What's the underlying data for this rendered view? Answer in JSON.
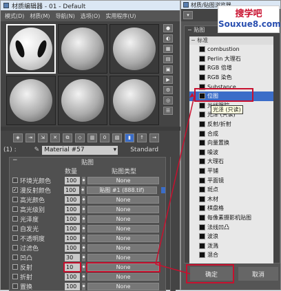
{
  "editor": {
    "title": "材质编辑器 - 01 - Default",
    "menu": [
      "模式(D)",
      "材质(M)",
      "导航(N)",
      "选项(O)",
      "实用程序(U)"
    ],
    "material_index": "(1) :",
    "material_name": "Material #57",
    "material_type": "Standard",
    "rollout_title": "贴图",
    "col_amount": "数量",
    "col_maptype": "贴图类型",
    "rows": [
      {
        "check": "",
        "label": "环境光颜色",
        "amount": "100",
        "map": "None"
      },
      {
        "check": "✓",
        "label": "漫反射颜色",
        "amount": "100",
        "map": "贴图 #1 (888.tif)"
      },
      {
        "check": "",
        "label": "高光颜色",
        "amount": "100",
        "map": "None"
      },
      {
        "check": "",
        "label": "高光级别",
        "amount": "100",
        "map": "None"
      },
      {
        "check": "",
        "label": "光泽度",
        "amount": "100",
        "map": "None"
      },
      {
        "check": "",
        "label": "自发光",
        "amount": "100",
        "map": "None"
      },
      {
        "check": "",
        "label": "不透明度",
        "amount": "100",
        "map": "None"
      },
      {
        "check": "",
        "label": "过滤色",
        "amount": "100",
        "map": "None"
      },
      {
        "check": "",
        "label": "凹凸",
        "amount": "30",
        "map": "None"
      },
      {
        "check": "",
        "label": "反射",
        "amount": "10",
        "map": "None"
      },
      {
        "check": "",
        "label": "折射",
        "amount": "100",
        "map": "None"
      },
      {
        "check": "",
        "label": "置换",
        "amount": "100",
        "map": "None"
      }
    ]
  },
  "browser": {
    "title": "材质/贴图浏览器",
    "section": "贴图",
    "subsection": "标准",
    "items": [
      "combustion",
      "Perlin 大理石",
      "RGB 倍增",
      "RGB 染色",
      "Substance",
      "位图",
      "光线跟踪",
      "光泽 (只读)",
      "反射/折射",
      "合成",
      "向量置换",
      "噪波",
      "大理石",
      "平铺",
      "平面镜",
      "斑点",
      "木材",
      "棋盘格",
      "每像素摄影机贴图",
      "法线凹凸",
      "波浪",
      "泼溅",
      "混合"
    ],
    "selected": "位图",
    "tooltip": "光泽 (只读)",
    "ok": "确定",
    "cancel": "取消"
  },
  "watermark": {
    "line1": "搜学吧",
    "line2": "Souxue8.com"
  },
  "colors": {
    "highlight": "#c8102e",
    "select": "#3b6dc8"
  }
}
